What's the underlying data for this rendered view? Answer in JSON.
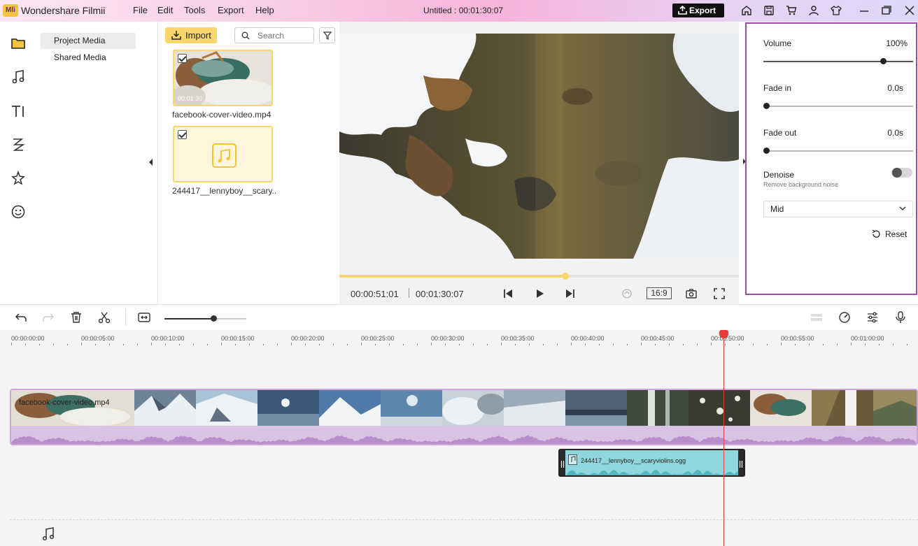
{
  "titlebar": {
    "logo_text": "Mli",
    "app_name": "Wondershare Filmii",
    "menus": [
      "File",
      "Edit",
      "Tools",
      "Export",
      "Help"
    ],
    "project_title": "Untitled :",
    "project_duration": "00:01:30:07",
    "export_label": "Export",
    "icons": [
      "home-icon",
      "save-icon",
      "cart-icon",
      "user-icon",
      "shirt-icon",
      "minimize-icon",
      "maximize-icon",
      "close-icon"
    ]
  },
  "leftnav": {
    "items": [
      "media-folder-icon",
      "music-icon",
      "text-icon",
      "transition-icon",
      "effects-icon",
      "sticker-icon"
    ],
    "bottom_icons": [
      "new-folder-icon",
      "folder-disabled-icon"
    ]
  },
  "media_panel": {
    "tabs": [
      "Project Media",
      "Shared Media"
    ]
  },
  "library": {
    "import_label": "Import",
    "search_placeholder": "Search",
    "items": [
      {
        "name": "facebook-cover-video.mp4",
        "duration": "00:01:30"
      },
      {
        "name": "244417__lennyboy__scary..."
      }
    ]
  },
  "preview": {
    "current_time": "00:00:51:01",
    "total_time": "00:01:30:07",
    "aspect_ratio": "16:9",
    "progress": 0.565
  },
  "properties": {
    "volume_label": "Volume",
    "volume_value": "100%",
    "volume_level": 0.8,
    "fade_in_label": "Fade in",
    "fade_in_value": "0.0s",
    "fade_out_label": "Fade out",
    "fade_out_value": "0.0s",
    "denoise_label": "Denoise",
    "denoise_desc": "Remove background noise",
    "denoise_on": false,
    "denoise_level": "Mid",
    "reset_label": "Reset",
    "accent": "#9b4ea3"
  },
  "timeline": {
    "ruler": [
      "00:00:00:00",
      "00:00:05:00",
      "00:00:10:00",
      "00:00:15:00",
      "00:00:20:00",
      "00:00:25:00",
      "00:00:30:00",
      "00:00:35:00",
      "00:00:40:00",
      "00:00:45:00",
      "00:00:50:00",
      "00:00:55:00",
      "00:01:00:00"
    ],
    "video_clip_name": "facebook-cover-video.mp4",
    "audio_clip_name": "244417__lennyboy__scaryviolins.ogg",
    "zoom_level": 0.6
  }
}
